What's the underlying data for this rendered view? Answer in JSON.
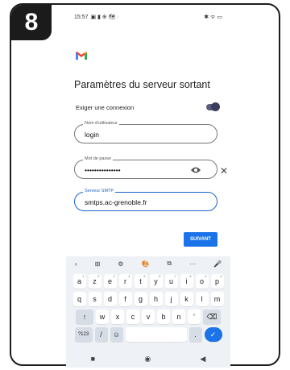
{
  "step": "8",
  "status": {
    "time": "15:57",
    "left_icons": "▣ ▮ ⊕ 🗺 ·",
    "right_icons": "✱ ᯤ ▭"
  },
  "app": {
    "title": "Paramètres du serveur sortant",
    "require_connection_label": "Exiger une connexion"
  },
  "fields": {
    "username": {
      "label": "Nom d'utilisateur",
      "value": "login"
    },
    "password": {
      "label": "Mot de passe",
      "value": "•••••••••••••••"
    },
    "smtp": {
      "label": "Serveur SMTP",
      "value": "smtps.ac-grenoble.fr"
    }
  },
  "buttons": {
    "next": "SUIVANT"
  },
  "keyboard": {
    "toolbar": [
      "‹",
      "⊞",
      "⚙",
      "🎨",
      "⧉",
      "···",
      "🎤"
    ],
    "row1": [
      [
        "a",
        "1"
      ],
      [
        "z",
        "2"
      ],
      [
        "e",
        "3"
      ],
      [
        "r",
        "4"
      ],
      [
        "t",
        "5"
      ],
      [
        "y",
        "6"
      ],
      [
        "u",
        "7"
      ],
      [
        "i",
        "8"
      ],
      [
        "o",
        "9"
      ],
      [
        "p",
        "0"
      ]
    ],
    "row2": [
      "q",
      "s",
      "d",
      "f",
      "g",
      "h",
      "j",
      "k",
      "l",
      "m"
    ],
    "row3": [
      "w",
      "x",
      "c",
      "v",
      "b",
      "n",
      "'"
    ],
    "row4": {
      "sym": "?123",
      "slash": "/",
      "emoji": "☺"
    },
    "shift": "↑",
    "backspace": "⌫",
    "enter": "✓"
  },
  "nav": {
    "recents": "■",
    "home": "◉",
    "back": "◀"
  },
  "colors": {
    "accent": "#1a73e8",
    "badge": "#1b1b1b"
  }
}
